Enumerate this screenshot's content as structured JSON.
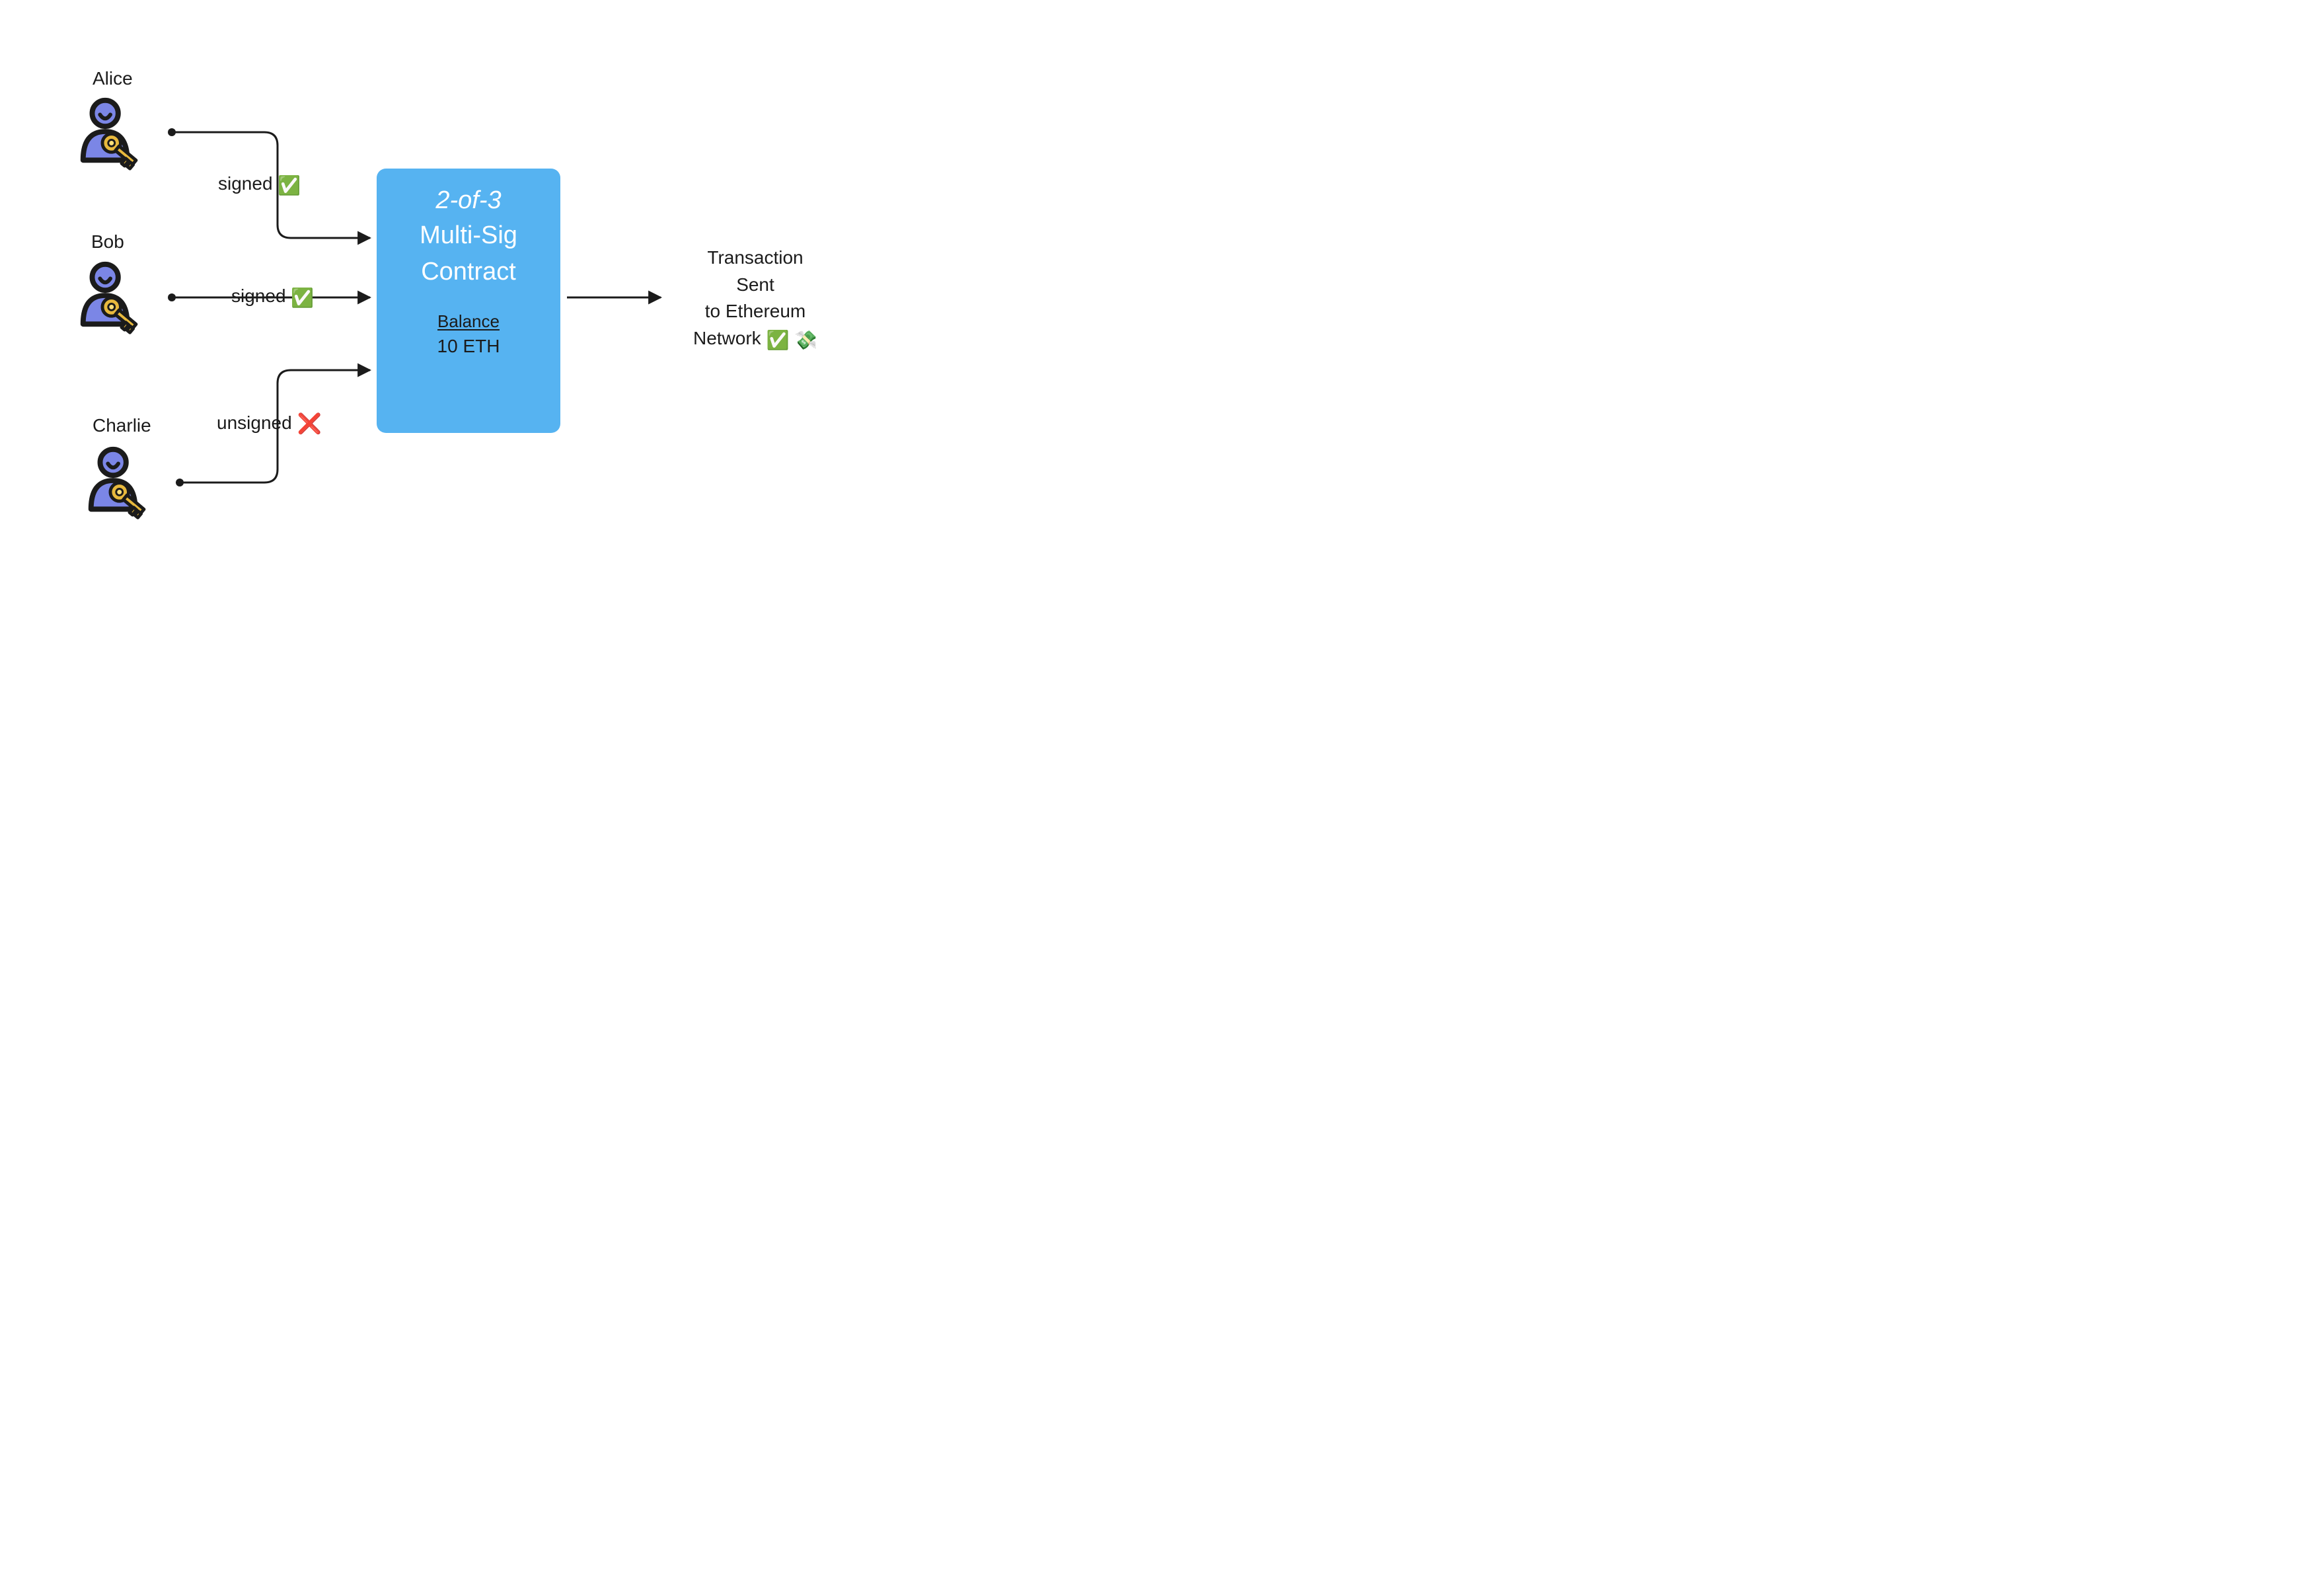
{
  "signers": {
    "alice": {
      "label": "Alice",
      "edge_label": "signed",
      "status_glyph": "✅"
    },
    "bob": {
      "label": "Bob",
      "edge_label": "signed",
      "status_glyph": "✅"
    },
    "charlie": {
      "label": "Charlie",
      "edge_label": "unsigned",
      "status_glyph": "❌"
    }
  },
  "contract": {
    "policy_text": "2-of-3",
    "line2": "Multi-Sig",
    "line3": "Contract",
    "balance_label": "Balance",
    "balance_value": "10 ETH"
  },
  "output": {
    "line1": "Transaction",
    "line2": "Sent",
    "line3": "to Ethereum",
    "line4_text": "Network",
    "line4_glyph1": "✅",
    "line4_glyph2": "💸"
  },
  "colors": {
    "box_bg": "#56b3f1",
    "stroke": "#1b1b1b",
    "person_fill": "#7b86e6",
    "key_fill": "#e8b93d",
    "key_hi": "#ffe07a"
  }
}
